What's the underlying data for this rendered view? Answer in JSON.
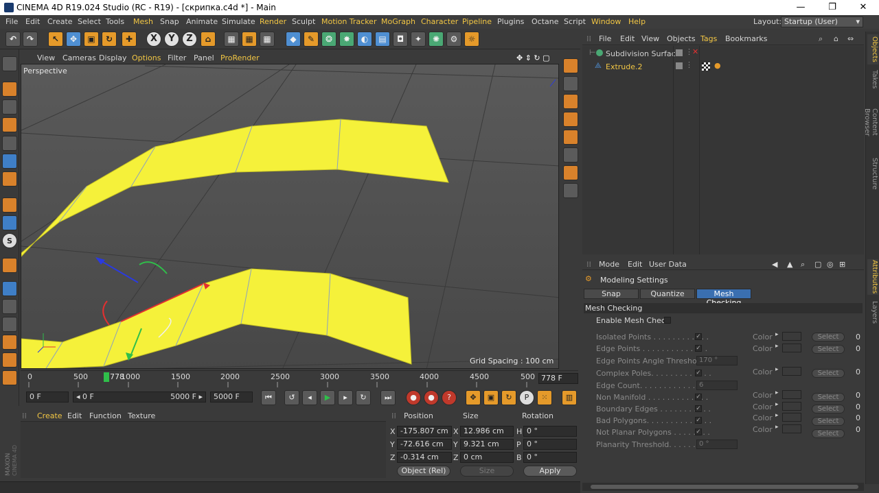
{
  "window": {
    "title": "CINEMA 4D R19.024 Studio (RC - R19) - [скрипка.c4d *] - Main",
    "minimize": "—",
    "restore": "❐",
    "close": "✕"
  },
  "menu": {
    "items": [
      "File",
      "Edit",
      "Create",
      "Select",
      "Tools",
      "Mesh",
      "Snap",
      "Animate",
      "Simulate",
      "Render",
      "Sculpt",
      "Motion Tracker",
      "MoGraph",
      "Character",
      "Pipeline",
      "Plugins",
      "Octane",
      "Script",
      "Window",
      "Help"
    ],
    "layout_label": "Layout:",
    "layout_value": "Startup (User)"
  },
  "toolbar": {
    "axis_x": "X",
    "axis_y": "Y",
    "axis_z": "Z"
  },
  "viewport": {
    "menu": [
      "View",
      "Cameras",
      "Display",
      "Options",
      "Filter",
      "Panel",
      "ProRender"
    ],
    "label": "Perspective",
    "grid_spacing": "Grid Spacing : 100 cm"
  },
  "timeline": {
    "ticks": [
      "0",
      "500",
      "1000",
      "1500",
      "2000",
      "2500",
      "3000",
      "3500",
      "4000",
      "4500",
      "500"
    ],
    "current_frame_marker": "778",
    "frame_field": "778 F",
    "start_field": "0 F",
    "preview_start": "◂ 0 F",
    "preview_end": "5000 F ▸",
    "end_field": "5000 F"
  },
  "material": {
    "menu": [
      "Create",
      "Edit",
      "Function",
      "Texture"
    ]
  },
  "coordinates": {
    "headers": [
      "Position",
      "Size",
      "Rotation"
    ],
    "rows": [
      {
        "axis": "X",
        "pos": "-175.807 cm",
        "size_axis": "X",
        "size": "12.986 cm",
        "rot_axis": "H",
        "rot": "0 °"
      },
      {
        "axis": "Y",
        "pos": "-72.616 cm",
        "size_axis": "Y",
        "size": "9.321 cm",
        "rot_axis": "P",
        "rot": "0 °"
      },
      {
        "axis": "Z",
        "pos": "-0.314 cm",
        "size_axis": "Z",
        "size": "0 cm",
        "rot_axis": "B",
        "rot": "0 °"
      }
    ],
    "mode": "Object (Rel)",
    "size_mode": "Size",
    "apply": "Apply"
  },
  "logo": {
    "text": "MAXON CINEMA 4D"
  },
  "objects": {
    "menu": [
      "File",
      "Edit",
      "View",
      "Objects",
      "Tags",
      "Bookmarks"
    ],
    "items": [
      {
        "name": "Subdivision Surface",
        "color": "#d0d0d0"
      },
      {
        "name": "Extrude.2",
        "color": "#f3c744"
      }
    ]
  },
  "side_tabs": [
    "Objects",
    "Takes",
    "Content Browser",
    "Structure",
    "Attributes",
    "Layers"
  ],
  "attributes": {
    "menu": [
      "Mode",
      "Edit",
      "User Data"
    ],
    "title": "Modeling Settings",
    "tabs": [
      "Snap",
      "Quantize",
      "Mesh Checking"
    ],
    "section": "Mesh Checking",
    "enable": "Enable Mesh Check",
    "color_label": "Color",
    "select_label": "Select",
    "props": [
      {
        "label": "Isolated Points . . . . . . . . . . . .",
        "has_color": true,
        "count": "0"
      },
      {
        "label": "Edge Points . . . . . . . . . . . . . .",
        "has_color": true,
        "count": "0"
      },
      {
        "label": "Edge Points Angle Threshold",
        "value": "170 °"
      },
      {
        "label": "Complex Poles. . . . . . . . . . . . .",
        "has_color": true,
        "count": "0"
      },
      {
        "label": "Edge Count. . . . . . . . . . . . . . .",
        "value": "6"
      },
      {
        "label": "Non Manifold . . . . . . . . . . . . .",
        "has_color": true,
        "count": "0"
      },
      {
        "label": "Boundary Edges . . . . . . . . . . .",
        "has_color": true,
        "count": "0"
      },
      {
        "label": "Bad Polygons. . . . . . . . . . . . . .",
        "has_color": true,
        "count": "0"
      },
      {
        "label": "Not Planar Polygons . . . . . . . .",
        "has_color": true,
        "count": "0"
      },
      {
        "label": "Planarity Threshold. . . . . . . . .",
        "value": "0 °"
      }
    ]
  },
  "colors": {
    "accent": "#f3c744",
    "mesh_yellow": "#f5f13a",
    "active_tab": "#3a6fb0"
  }
}
